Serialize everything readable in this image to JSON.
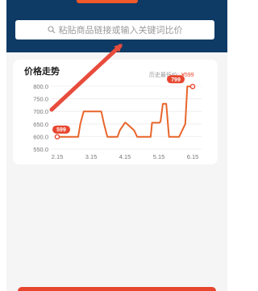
{
  "search": {
    "placeholder": "粘贴商品链接或输入关键词比价",
    "icon": "search-icon"
  },
  "price_card": {
    "title": "价格走势",
    "lowest_label": "历史最低价:",
    "lowest_value": "¥599"
  },
  "chart_data": {
    "type": "line",
    "title": "价格走势",
    "xlabel": "",
    "ylabel": "",
    "ylim": [
      550,
      800
    ],
    "yticks": [
      "800.0",
      "750.0",
      "700.0",
      "650.0",
      "600.0",
      "550.0"
    ],
    "xticks": [
      "2.15",
      "3.15",
      "4.15",
      "5.15",
      "6.15"
    ],
    "series": [
      {
        "color": "#e8652a",
        "x": [
          0,
          0.62,
          0.68,
          0.78,
          0.82,
          1.3,
          1.38,
          1.48,
          1.55,
          1.78,
          1.85,
          2.0,
          2.02,
          2.27,
          2.36,
          2.46,
          2.52,
          2.76,
          2.8,
          3.0,
          3.02,
          3.05,
          3.12,
          3.22,
          3.3,
          3.55,
          3.6,
          3.78,
          3.84,
          4.0
        ],
        "y": [
          599,
          599,
          650,
          700,
          700,
          700,
          650,
          599,
          599,
          599,
          625,
          655,
          655,
          625,
          599,
          599,
          599,
          599,
          655,
          655,
          655,
          660,
          730,
          730,
          599,
          599,
          599,
          650,
          799,
          799
        ]
      }
    ],
    "annotations": [
      {
        "label": "599",
        "x": 0,
        "y": 599,
        "color": "#e8452e"
      },
      {
        "label": "799",
        "x": 4.0,
        "y": 799,
        "color": "#e8452e"
      }
    ],
    "grid": true
  },
  "overlay": {
    "arrow_color": "#e74c3c"
  }
}
